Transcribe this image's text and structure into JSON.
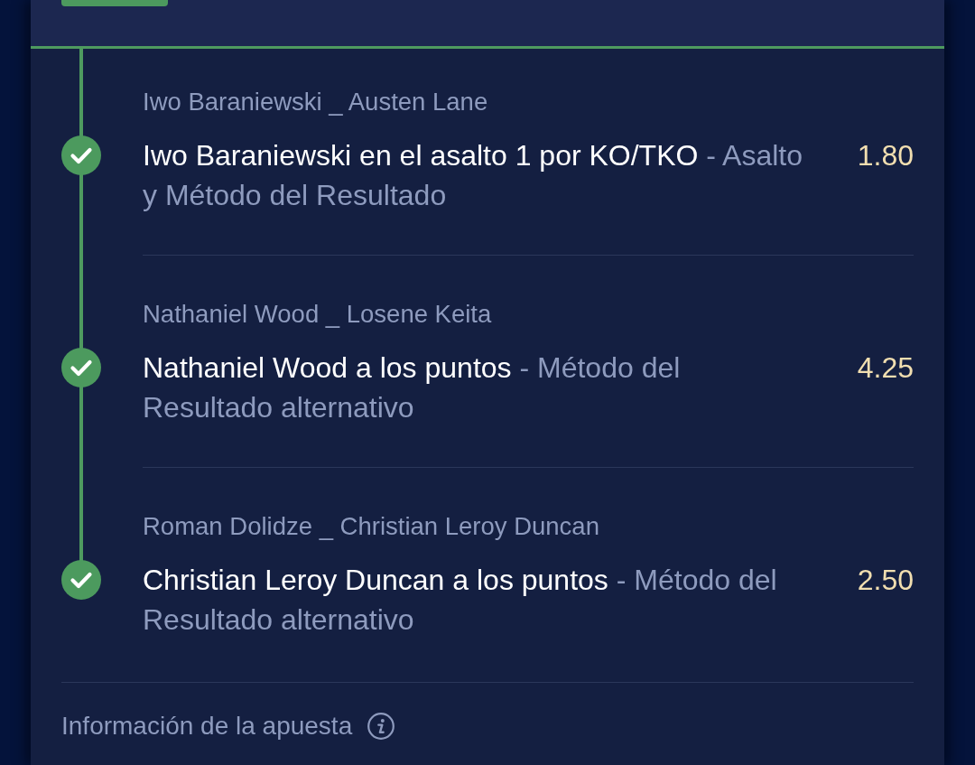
{
  "selections": [
    {
      "event": "Iwo Baraniewski _ Austen Lane",
      "pick": "Iwo Baraniewski en el asalto 1 por KO/TKO",
      "market": "- Asalto y Método del Resultado",
      "odds": "1.80",
      "won": true
    },
    {
      "event": "Nathaniel Wood _ Losene Keita",
      "pick": "Nathaniel Wood a los puntos",
      "market": "- Método del Resultado alternativo",
      "odds": "4.25",
      "won": true
    },
    {
      "event": "Roman Dolidze _ Christian Leroy Duncan",
      "pick": "Christian Leroy Duncan a los puntos",
      "market": "- Método del Resultado alternativo",
      "odds": "2.50",
      "won": true
    }
  ],
  "footer": {
    "label": "Información de la apuesta"
  }
}
